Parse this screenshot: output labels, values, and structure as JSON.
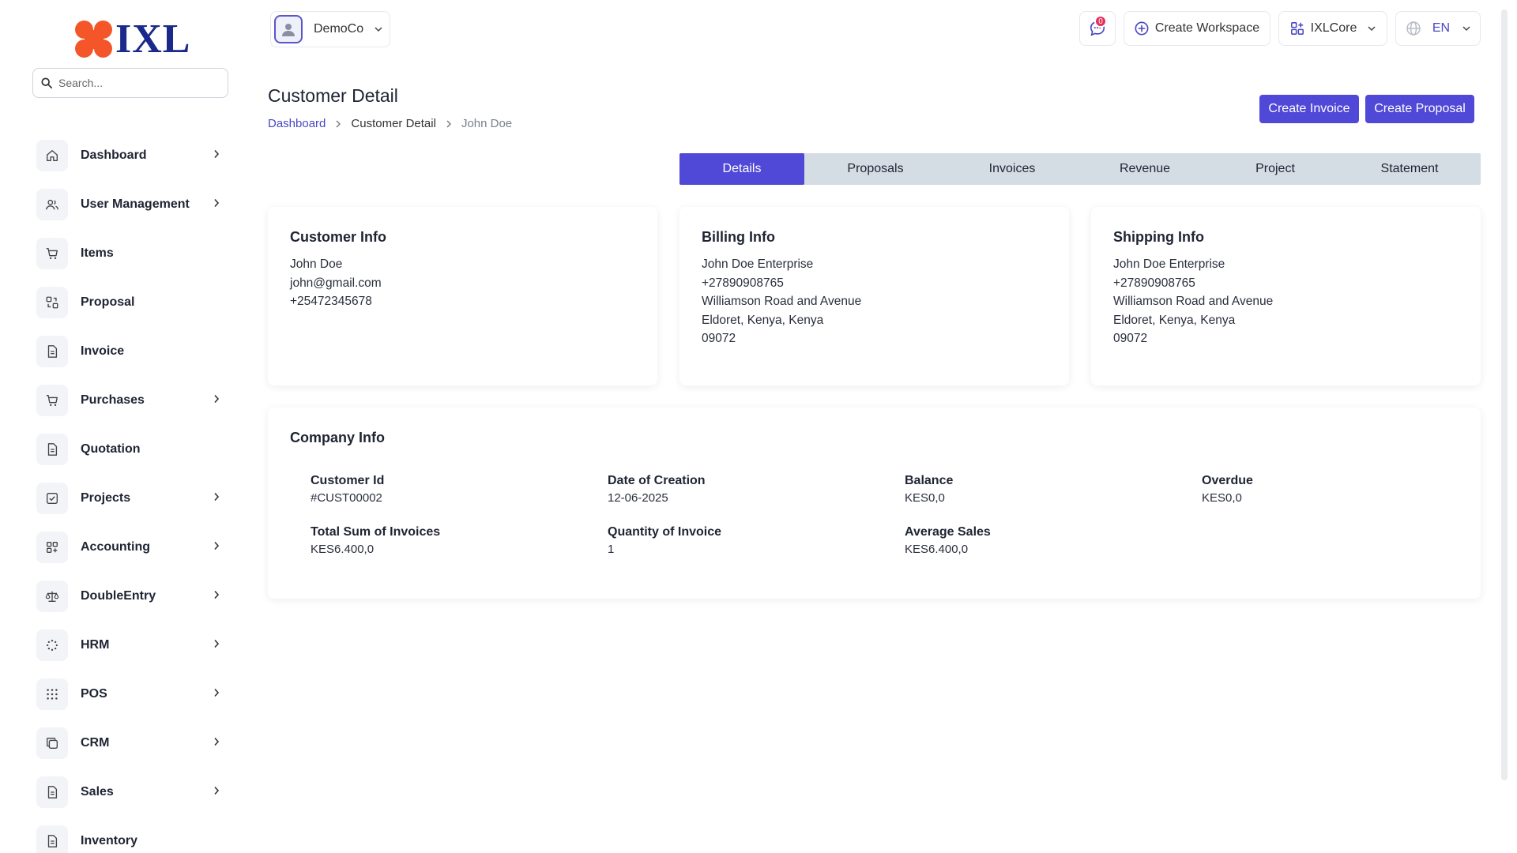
{
  "brand": {
    "name": "IXL",
    "accent": "#5048d6",
    "logo_color": "#f4562a"
  },
  "search": {
    "placeholder": "Search..."
  },
  "sidebar": {
    "items": [
      {
        "label": "Dashboard",
        "icon": "home-icon",
        "has_children": true
      },
      {
        "label": "User Management",
        "icon": "users-icon",
        "has_children": true
      },
      {
        "label": "Items",
        "icon": "cart-icon",
        "has_children": false
      },
      {
        "label": "Proposal",
        "icon": "swap-icon",
        "has_children": false
      },
      {
        "label": "Invoice",
        "icon": "file-icon",
        "has_children": false
      },
      {
        "label": "Purchases",
        "icon": "cart-icon",
        "has_children": true
      },
      {
        "label": "Quotation",
        "icon": "file-icon",
        "has_children": false
      },
      {
        "label": "Projects",
        "icon": "check-square-icon",
        "has_children": true
      },
      {
        "label": "Accounting",
        "icon": "grid-plus-icon",
        "has_children": true
      },
      {
        "label": "DoubleEntry",
        "icon": "scale-icon",
        "has_children": true
      },
      {
        "label": "HRM",
        "icon": "dots-circle-icon",
        "has_children": true
      },
      {
        "label": "POS",
        "icon": "dots-grid-icon",
        "has_children": true
      },
      {
        "label": "CRM",
        "icon": "copy-icon",
        "has_children": true
      },
      {
        "label": "Sales",
        "icon": "file-icon",
        "has_children": true
      },
      {
        "label": "Inventory",
        "icon": "file-icon",
        "has_children": false
      }
    ]
  },
  "topbar": {
    "workspace": "DemoCo",
    "notifications_count": "0",
    "create_workspace": "Create Workspace",
    "app_switch": "IXLCore",
    "language": "EN"
  },
  "page": {
    "title": "Customer Detail",
    "breadcrumb": [
      "Dashboard",
      "Customer Detail",
      "John Doe"
    ],
    "actions": {
      "create_invoice": "Create Invoice",
      "create_proposal": "Create Proposal"
    }
  },
  "tabs": [
    "Details",
    "Proposals",
    "Invoices",
    "Revenue",
    "Project",
    "Statement"
  ],
  "customer_info": {
    "title": "Customer Info",
    "lines": [
      "John Doe",
      "john@gmail.com",
      "+25472345678"
    ]
  },
  "billing_info": {
    "title": "Billing Info",
    "lines": [
      "John Doe Enterprise",
      "+27890908765",
      "Williamson Road and Avenue",
      "Eldoret, Kenya, Kenya",
      "09072"
    ]
  },
  "shipping_info": {
    "title": "Shipping Info",
    "lines": [
      "John Doe Enterprise",
      "+27890908765",
      "Williamson Road and Avenue",
      "Eldoret, Kenya, Kenya",
      "09072"
    ]
  },
  "company_info": {
    "title": "Company Info",
    "fields": [
      {
        "label": "Customer Id",
        "value": "#CUST00002"
      },
      {
        "label": "Date of Creation",
        "value": "12-06-2025"
      },
      {
        "label": "Balance",
        "value": "KES0,0"
      },
      {
        "label": "Overdue",
        "value": "KES0,0"
      },
      {
        "label": "Total Sum of Invoices",
        "value": "KES6.400,0"
      },
      {
        "label": "Quantity of Invoice",
        "value": "1"
      },
      {
        "label": "Average Sales",
        "value": "KES6.400,0"
      }
    ]
  }
}
